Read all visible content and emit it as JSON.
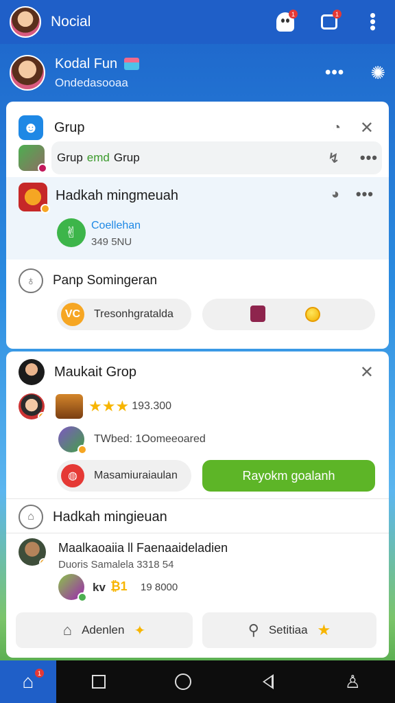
{
  "topbar": {
    "title": "Nocial",
    "notif_badge": "1",
    "msg_badge": "1"
  },
  "profile": {
    "name": "Kodal Fun",
    "subtitle": "Ondedasooaa"
  },
  "card1": {
    "header": "Grup",
    "item1": {
      "text_a": "Grup",
      "text_b": "emd",
      "text_c": "Grup"
    },
    "item2": {
      "title": "Hadkah mingmeuah",
      "link": "Coellehan",
      "count": "349 5NU"
    },
    "section": {
      "title": "Panp Somingeran",
      "pill_left": "Tresonhgratalda",
      "pill_left_icon": "VC"
    }
  },
  "card2": {
    "header": "Maukait Grop",
    "row1": {
      "score": "193.300"
    },
    "row2": {
      "text": "TWbed: 1Oomeeoared"
    },
    "buttons": {
      "left": "Masamiuraiaulan",
      "right": "Rayokm goalanh"
    },
    "section": {
      "title": "Hadkah mingieuan"
    },
    "entry": {
      "title": "Maalkaoaiia ll Faenaaideladien",
      "subtitle": "Duoris Samalela 3318 54",
      "kv": "kv",
      "mult": "₿1",
      "amount": "19 8000"
    },
    "footer": {
      "left": "Adenlen",
      "right": "Setitiaa"
    }
  },
  "nav": {
    "home_badge": "1"
  },
  "colors": {
    "primary": "#1f5fc8",
    "accent_green": "#5db527",
    "star": "#f7b500"
  }
}
